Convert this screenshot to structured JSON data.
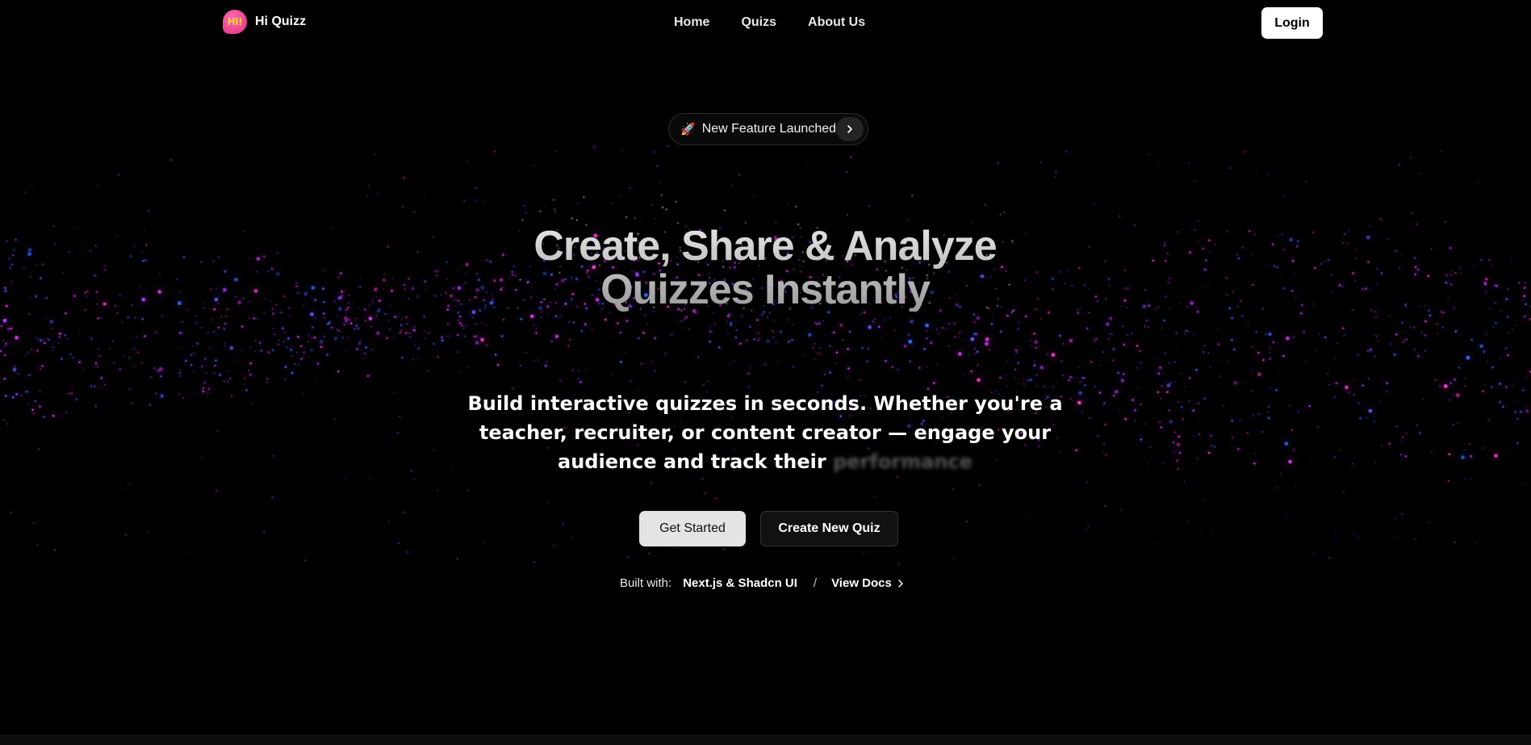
{
  "nav": {
    "brand": {
      "logo_text": "HI!",
      "name": "Hi Quizz",
      "logo_colors": [
        "#ff6ab0",
        "#e0337f",
        "#ffd23c"
      ]
    },
    "links": [
      {
        "label": "Home"
      },
      {
        "label": "Quizs"
      },
      {
        "label": "About Us"
      }
    ],
    "login_label": "Login"
  },
  "announcement": {
    "emoji": "🚀",
    "text": "New Feature Launched",
    "arrow_icon": "chevron-right-icon"
  },
  "hero": {
    "title_line1": "Create, Share & Analyze",
    "title_line2": "Quizzes Instantly",
    "subtitle_main": "Build interactive quizzes in seconds. Whether you're a teacher, recruiter, or content creator — engage your audience and track their",
    "subtitle_blurred_word": "performance"
  },
  "cta": {
    "primary_label": "Get Started",
    "secondary_label": "Create New Quiz"
  },
  "built_with": {
    "label": "Built with:",
    "tech": "Next.js & Shadcn UI",
    "separator": "/",
    "docs_label": "View Docs"
  },
  "theme": {
    "background": "#000000",
    "particle_colors": [
      "#e040fb",
      "#ff3fd8",
      "#6a5cff",
      "#3d6bff",
      "#b03cff"
    ]
  }
}
